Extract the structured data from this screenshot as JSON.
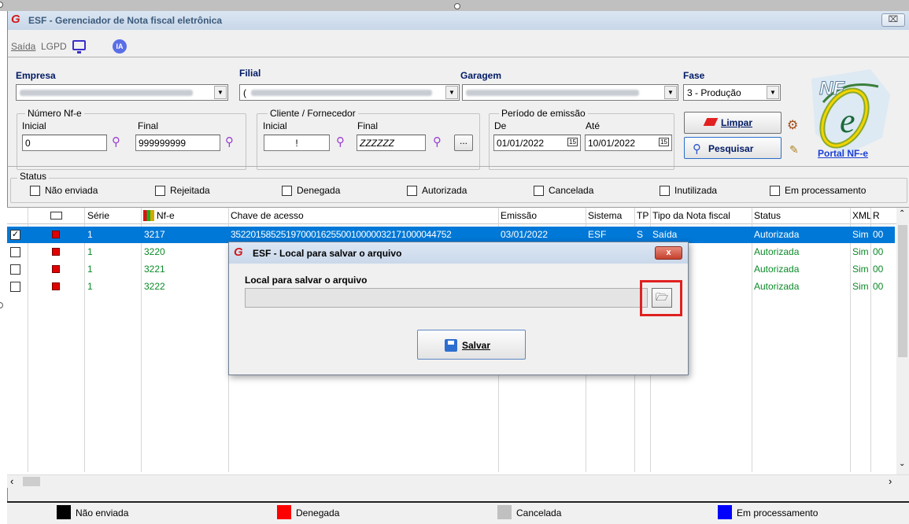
{
  "window": {
    "title": "ESF - Gerenciador de Nota fiscal eletrônica",
    "logo_glyph": "G",
    "close_glyph": "⌧"
  },
  "menu": {
    "saida": "Saída",
    "lgpd": "LGPD",
    "ia": "IA"
  },
  "filters": {
    "empresa_label": "Empresa",
    "filial_label": "Filial",
    "filial_value": "(",
    "garagem_label": "Garagem",
    "fase_label": "Fase",
    "fase_value": "3 - Produção",
    "numero_group": "Número Nf-e",
    "inicial_label": "Inicial",
    "final_label": "Final",
    "numero_inicial": "0",
    "numero_final": "999999999",
    "cliente_group": "Cliente / Fornecedor",
    "cliente_inicial": "!",
    "cliente_final": "ZZZZZZ",
    "ellipsis": "...",
    "periodo_group": "Período de emissão",
    "de_label": "De",
    "ate_label": "Até",
    "data_de": "01/01/2022",
    "data_ate": "10/01/2022",
    "calendar_glyph": "15"
  },
  "buttons": {
    "limpar": "Limpar",
    "pesquisar": "Pesquisar",
    "portal": "Portal NF-e"
  },
  "status_filter": {
    "group": "Status",
    "options": [
      "Não enviada",
      "Rejeitada",
      "Denegada",
      "Autorizada",
      "Cancelada",
      "Inutilizada",
      "Em processamento"
    ]
  },
  "grid": {
    "headers": [
      "Série",
      "Nf-e",
      "Chave de acesso",
      "Emissão",
      "Sistema",
      "TP",
      "Tipo da Nota fiscal",
      "Status",
      "XML",
      "R"
    ],
    "rows": [
      {
        "checked": true,
        "serie": "1",
        "nfe": "3217",
        "chave": "35220158525197000162550010000032171000044752",
        "emissao": "03/01/2022",
        "sistema": "ESF",
        "tp": "S",
        "tipo": "Saída",
        "status": "Autorizada",
        "xml": "Sim",
        "r": "00"
      },
      {
        "checked": false,
        "serie": "1",
        "nfe": "3220",
        "chave": "",
        "emissao": "",
        "sistema": "",
        "tp": "",
        "tipo": "",
        "status": "Autorizada",
        "xml": "Sim",
        "r": "00"
      },
      {
        "checked": false,
        "serie": "1",
        "nfe": "3221",
        "chave": "",
        "emissao": "",
        "sistema": "",
        "tp": "",
        "tipo": "",
        "status": "Autorizada",
        "xml": "Sim",
        "r": "00"
      },
      {
        "checked": false,
        "serie": "1",
        "nfe": "3222",
        "chave": "",
        "emissao": "",
        "sistema": "",
        "tp": "",
        "tipo": "",
        "status": "Autorizada",
        "xml": "Sim",
        "r": "00"
      }
    ]
  },
  "legend": [
    {
      "label": "Não enviada",
      "color": "#000000"
    },
    {
      "label": "Denegada",
      "color": "#ff0000"
    },
    {
      "label": "Cancelada",
      "color": "#c0c0c0"
    },
    {
      "label": "Em processamento",
      "color": "#0000ff"
    }
  ],
  "modal": {
    "title": "ESF - Local para salvar o arquivo",
    "close_glyph": "x",
    "label": "Local para salvar o arquivo",
    "path_value": "",
    "browse_glyph": "🗁",
    "save_label": "Salvar"
  },
  "colors": {
    "selection": "#0078d7",
    "highlight": "#e02020",
    "nfe_green": "#0b8a28"
  }
}
